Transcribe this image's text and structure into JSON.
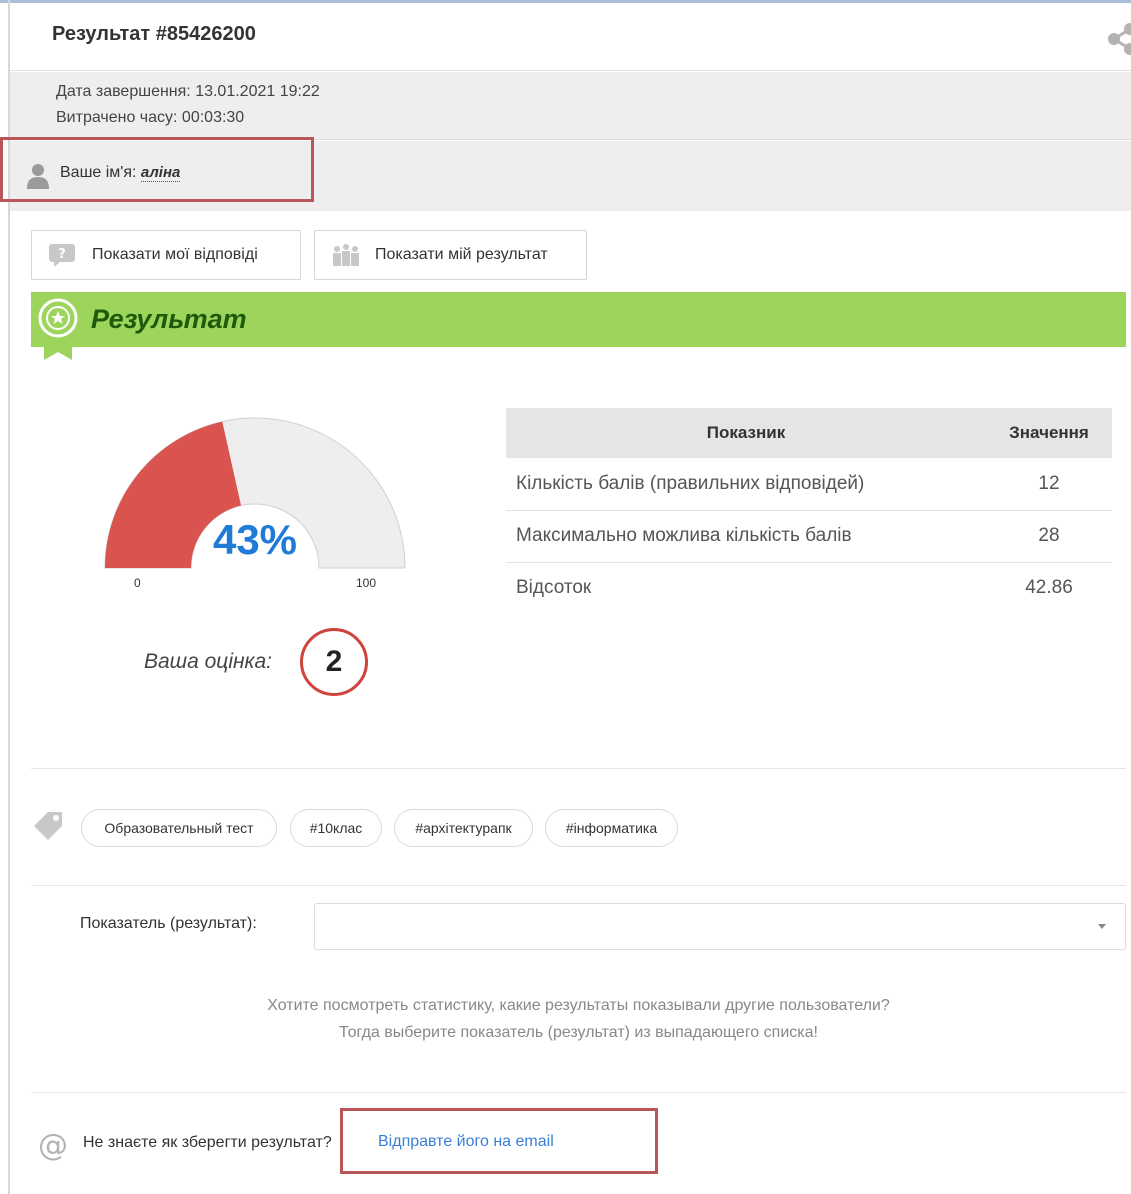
{
  "header": {
    "title": "Результат #85426200",
    "share_icon": "share-icon"
  },
  "meta": {
    "completed": "Дата завершення: 13.01.2021 19:22",
    "time_spent": "Витрачено часу: 00:03:30"
  },
  "user": {
    "label": "Ваше ім'я: ",
    "name": "аліна",
    "icon": "user-icon"
  },
  "buttons": {
    "show_answers": "Показати мої відповіді",
    "show_result": "Показати мій результат"
  },
  "result": {
    "title": "Результат",
    "percent": 43,
    "percent_label": "43%",
    "gauge_min": "0",
    "gauge_max": "100",
    "grade_label": "Ваша оцінка:",
    "grade": "2",
    "colors": {
      "fill": "#d9534f",
      "track": "#eeeeee",
      "bar": "#9dd45c",
      "percent_text": "#1f7bd7"
    }
  },
  "stats": {
    "headers": [
      "Показник",
      "Значення"
    ],
    "rows": [
      [
        "Кількість балів (правильних відповідей)",
        "12"
      ],
      [
        "Максимально можлива кількість балів",
        "28"
      ],
      [
        "Відсоток",
        "42.86"
      ]
    ]
  },
  "tags": [
    "Образовательный тест",
    "#10клас",
    "#архітектурапк",
    "#інформатика"
  ],
  "indicator": {
    "label": "Показатель (результат):",
    "value": ""
  },
  "hint": {
    "line1": "Хотите посмотреть статистику, какие результаты показывали другие пользователи?",
    "line2": "Тогда выберите показатель (результат) из выпадающего списка!"
  },
  "email": {
    "question": "Не знаєте як зберегти результат?",
    "link": "Відправте його на email"
  }
}
